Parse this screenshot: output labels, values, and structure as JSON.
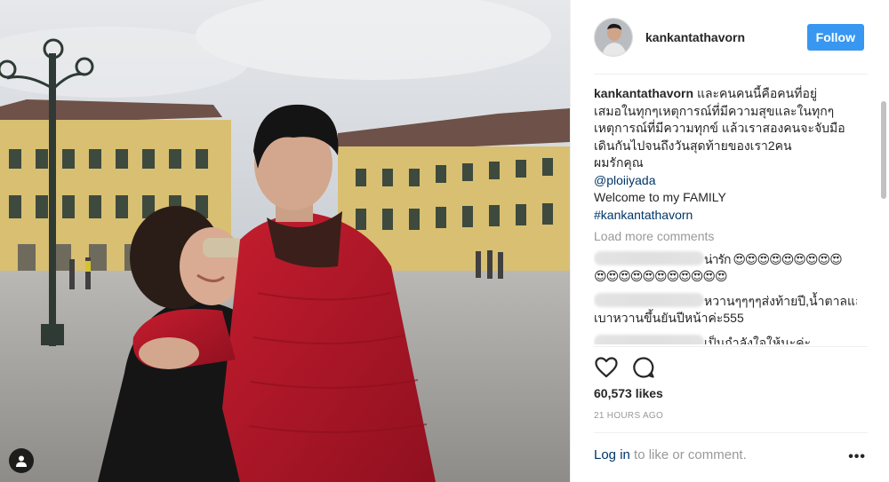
{
  "post": {
    "username": "kankantathavorn",
    "follow_label": "Follow",
    "caption": {
      "username": "kankantathavorn",
      "lines": [
        "และคนคนนี้คือคนที่อยู่",
        "เสมอในทุกๆเหตุการณ์ที่มีความสุขและในทุกๆ",
        "เหตุการณ์ที่มีความทุกข์ แล้วเราสองคนจะจับมือ",
        "เดินกันไปจนถึงวันสุดท้ายของเรา2คน",
        "ผมรักคุณ"
      ],
      "mention": "@ploiiyada",
      "welcome": "Welcome to my FAMILY",
      "hashtag": "#kankantathavorn"
    },
    "load_more_label": "Load more comments",
    "comments": [
      {
        "line1": "น่ารัก 😍😍😍😍😍😍😍😍😍",
        "line2": "😍😍😍😍😍😍😍😍😍😍😍"
      },
      {
        "line1": "หวานๆๆๆๆส่งท้ายปี,น้ำตาลและ",
        "line2": "เบาหวานขึ้นยันปีหน้าค่ะ555"
      },
      {
        "line1": "เป็นกำลังใจให้นะค่ะ",
        "line2": ""
      }
    ],
    "likes": "60,573 likes",
    "timestamp": "21 HOURS AGO",
    "login_link": "Log in",
    "login_rest": " to like or comment.",
    "more_label": "•••"
  },
  "icons": {
    "like": "heart-icon",
    "comment": "comment-icon",
    "tag": "user-tag-icon",
    "more": "more-options-icon"
  },
  "colors": {
    "follow_button": "#3897f0",
    "link": "#003569",
    "muted": "#999999",
    "jacket": "#b8182a",
    "palace": "#d9bd6e"
  }
}
